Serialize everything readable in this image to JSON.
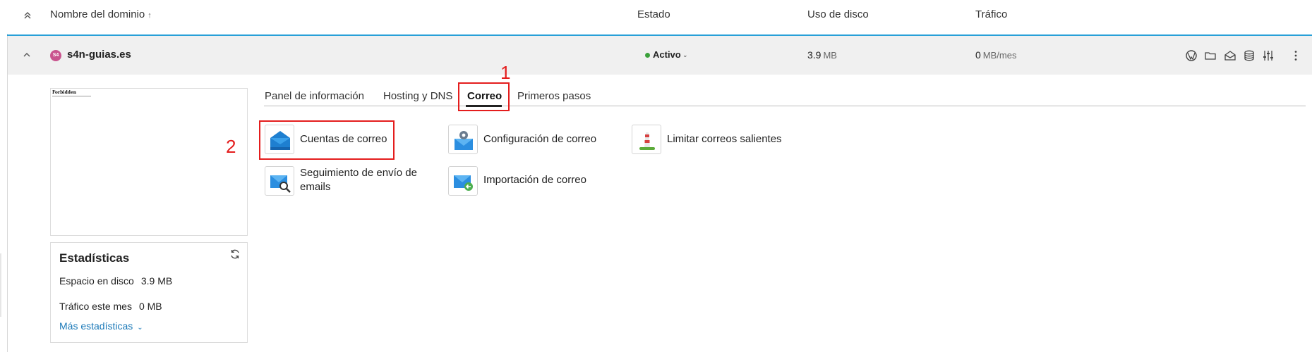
{
  "header": {
    "domain_col": "Nombre del dominio",
    "sort_arrow": "↑",
    "status_col": "Estado",
    "disk_col": "Uso de disco",
    "traffic_col": "Tráfico"
  },
  "domain": {
    "badge": "S4",
    "name": "s4n-guias.es",
    "status": "Activo",
    "disk_value": "3.9",
    "disk_unit": "MB",
    "traffic_value": "0",
    "traffic_unit": "MB/mes"
  },
  "thumbnail": {
    "title": "Forbidden",
    "line": ""
  },
  "stats": {
    "title": "Estadísticas",
    "disk_label": "Espacio en disco",
    "disk_value": "3.9 MB",
    "traffic_label": "Tráfico este mes",
    "traffic_value": "0 MB",
    "more_label": "Más estadísticas"
  },
  "tabs": [
    {
      "label": "Panel de información"
    },
    {
      "label": "Hosting y DNS"
    },
    {
      "label": "Correo"
    },
    {
      "label": "Primeros pasos"
    }
  ],
  "tools": {
    "mail_accounts": "Cuentas de correo",
    "mail_settings": "Configuración de correo",
    "limit_outgoing": "Limitar correos salientes",
    "tracking_line1": "Seguimiento de envío de",
    "tracking_line2": "emails",
    "mail_import": "Importación de correo"
  },
  "annotations": {
    "step1": "1",
    "step2": "2"
  },
  "colors": {
    "accent": "#28a0d8",
    "link": "#1b79b8",
    "annotation": "#e41d1d",
    "status_active": "#3aa13a"
  }
}
